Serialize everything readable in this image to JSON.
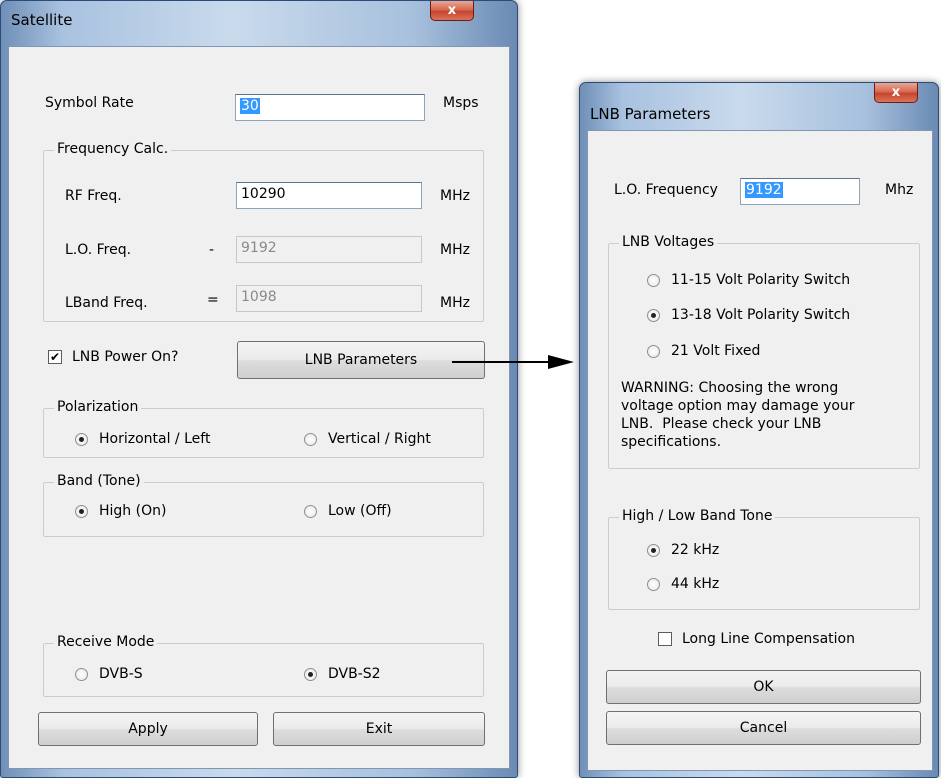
{
  "satellite": {
    "title": "Satellite",
    "close_glyph": "x",
    "symbol_rate": {
      "label": "Symbol Rate",
      "value": "30",
      "unit": "Msps"
    },
    "frequency_calc": {
      "legend": "Frequency Calc.",
      "rf": {
        "label": "RF Freq.",
        "value": "10290",
        "unit": "MHz"
      },
      "lo": {
        "label": "L.O. Freq.",
        "sign": "-",
        "value": "9192",
        "unit": "MHz"
      },
      "lband": {
        "label": "LBand Freq.",
        "sign": "=",
        "value": "1098",
        "unit": "MHz"
      }
    },
    "lnb_power": {
      "label": "LNB Power On?",
      "checked": true,
      "mark": "✔"
    },
    "lnb_parameters_button": "LNB Parameters",
    "polarization": {
      "legend": "Polarization",
      "options": [
        {
          "label": "Horizontal / Left",
          "selected": true
        },
        {
          "label": "Vertical / Right",
          "selected": false
        }
      ]
    },
    "band": {
      "legend": "Band (Tone)",
      "options": [
        {
          "label": "High (On)",
          "selected": true
        },
        {
          "label": "Low (Off)",
          "selected": false
        }
      ]
    },
    "receive_mode": {
      "legend": "Receive Mode",
      "options": [
        {
          "label": "DVB-S",
          "selected": false
        },
        {
          "label": "DVB-S2",
          "selected": true
        }
      ]
    },
    "apply_button": "Apply",
    "exit_button": "Exit"
  },
  "lnb_parameters": {
    "title": "LNB Parameters",
    "close_glyph": "x",
    "lo_frequency": {
      "label": "L.O. Frequency",
      "value": "9192",
      "unit": "Mhz"
    },
    "lnb_voltages": {
      "legend": "LNB Voltages",
      "options": [
        {
          "label": "11-15 Volt Polarity Switch",
          "selected": false
        },
        {
          "label": "13-18 Volt Polarity Switch",
          "selected": true
        },
        {
          "label": "21 Volt Fixed",
          "selected": false
        }
      ],
      "warning": "WARNING: Choosing the wrong voltage option may damage your LNB.  Please check your LNB specifications."
    },
    "band_tone": {
      "legend": "High / Low Band Tone",
      "options": [
        {
          "label": "22 kHz",
          "selected": true
        },
        {
          "label": "44 kHz",
          "selected": false
        }
      ]
    },
    "long_line": {
      "label": "Long Line Compensation",
      "checked": false
    },
    "ok_button": "OK",
    "cancel_button": "Cancel"
  },
  "colors": {
    "frame": "#a9c2e0",
    "client": "#f0f0f0",
    "close_button": "#d96a52",
    "selection": "#3399ff"
  }
}
